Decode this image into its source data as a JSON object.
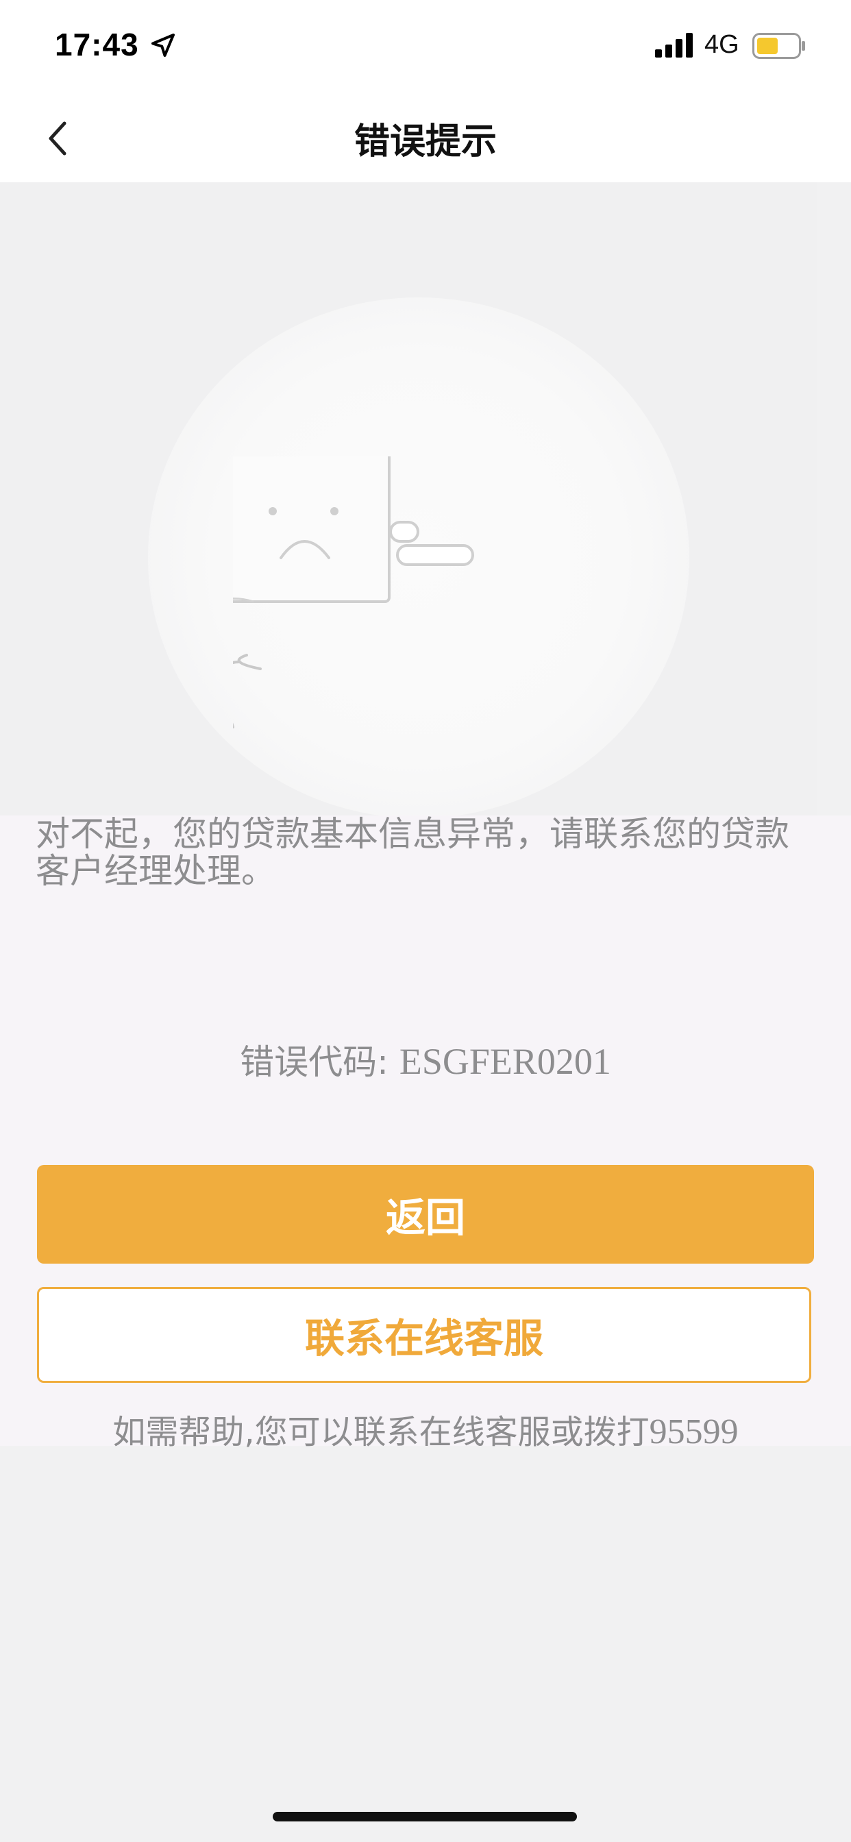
{
  "status_bar": {
    "time": "17:43",
    "network": "4G",
    "battery_color": "#f5c82e"
  },
  "nav": {
    "title": "错误提示",
    "back_icon": "chevron-left-icon"
  },
  "illustration": {
    "icon": "sad-window-icon"
  },
  "content": {
    "message": "对不起，您的贷款基本信息异常，请联系您的贷款客户经理处理。",
    "error_code_label": "错误代码: ",
    "error_code_value": "ESGFER0201",
    "return_button": "返回",
    "contact_button": "联系在线客服",
    "help_text": "如需帮助,您可以联系在线客服或拨打",
    "help_phone": "95599"
  },
  "colors": {
    "accent": "#f0ad3e",
    "muted_text": "#8d8d8f"
  }
}
